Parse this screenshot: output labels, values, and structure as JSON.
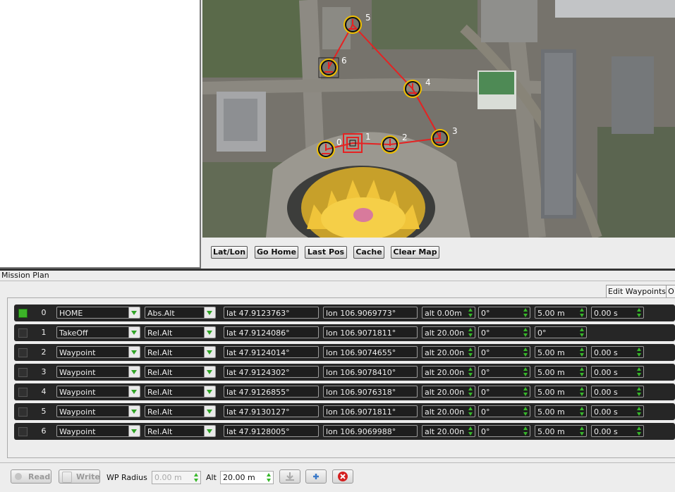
{
  "map": {
    "toolbar": {
      "latlon": "Lat/Lon",
      "go_home": "Go Home",
      "last_pos": "Last Pos",
      "cache": "Cache",
      "clear_map": "Clear Map"
    },
    "markers": [
      "0",
      "1",
      "2",
      "3",
      "4",
      "5",
      "6"
    ]
  },
  "mission": {
    "title": "Mission Plan",
    "tabs": {
      "edit": "Edit Waypoints",
      "other": "O"
    },
    "colors": {
      "row_bg": "#262626",
      "accent_green": "#3cb428",
      "route_red": "#e52222"
    },
    "rows": [
      {
        "checked": true,
        "index": "0",
        "command": "HOME",
        "frame": "Abs.Alt",
        "lat": "lat 47.9123763°",
        "lon": "lon 106.9069773°",
        "alt": "alt 0.00m",
        "p1": "0°",
        "p2": "5.00 m",
        "p3": "0.00 s"
      },
      {
        "checked": false,
        "index": "1",
        "command": "TakeOff",
        "frame": "Rel.Alt",
        "lat": "lat 47.9124086°",
        "lon": "lon 106.9071811°",
        "alt": "alt 20.00n",
        "p1": "0°",
        "p2": "0°",
        "p3": ""
      },
      {
        "checked": false,
        "index": "2",
        "command": "Waypoint",
        "frame": "Rel.Alt",
        "lat": "lat 47.9124014°",
        "lon": "lon 106.9074655°",
        "alt": "alt 20.00n",
        "p1": "0°",
        "p2": "5.00 m",
        "p3": "0.00 s"
      },
      {
        "checked": false,
        "index": "3",
        "command": "Waypoint",
        "frame": "Rel.Alt",
        "lat": "lat 47.9124302°",
        "lon": "lon 106.9078410°",
        "alt": "alt 20.00n",
        "p1": "0°",
        "p2": "5.00 m",
        "p3": "0.00 s"
      },
      {
        "checked": false,
        "index": "4",
        "command": "Waypoint",
        "frame": "Rel.Alt",
        "lat": "lat 47.9126855°",
        "lon": "lon 106.9076318°",
        "alt": "alt 20.00n",
        "p1": "0°",
        "p2": "5.00 m",
        "p3": "0.00 s"
      },
      {
        "checked": false,
        "index": "5",
        "command": "Waypoint",
        "frame": "Rel.Alt",
        "lat": "lat 47.9130127°",
        "lon": "lon 106.9071811°",
        "alt": "alt 20.00n",
        "p1": "0°",
        "p2": "5.00 m",
        "p3": "0.00 s"
      },
      {
        "checked": false,
        "index": "6",
        "command": "Waypoint",
        "frame": "Rel.Alt",
        "lat": "lat 47.9128005°",
        "lon": "lon 106.9069988°",
        "alt": "alt 20.00n",
        "p1": "0°",
        "p2": "5.00 m",
        "p3": "0.00 s"
      }
    ]
  },
  "bottom": {
    "read": "Read",
    "write": "Write",
    "wp_radius_label": "WP Radius",
    "wp_radius_value": "0.00 m",
    "alt_label": "Alt",
    "alt_value": "20.00 m",
    "icons": [
      "download-icon",
      "add-icon",
      "delete-icon"
    ]
  }
}
